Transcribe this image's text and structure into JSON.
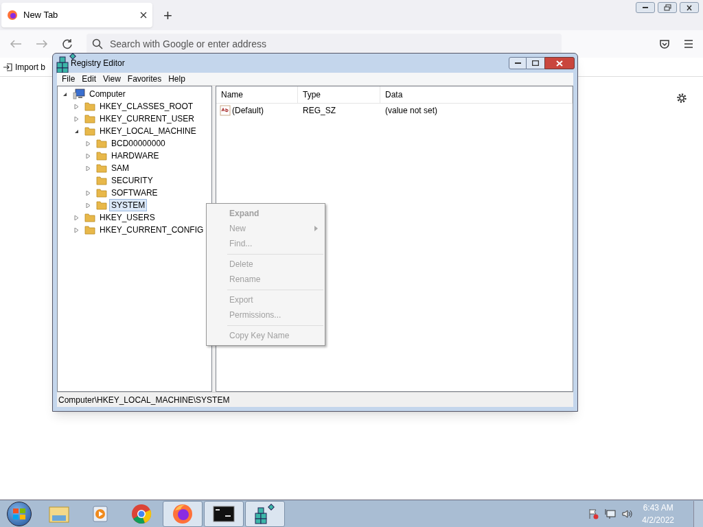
{
  "browser": {
    "tabs": [
      {
        "title": "New Tab",
        "selected": true
      }
    ],
    "new_tab": "+",
    "search": {
      "placeholder": "Search with Google or enter address"
    },
    "bookmarks_toolbar": {
      "import": "Import b"
    }
  },
  "registry_editor": {
    "title": "Registry Editor",
    "menu": [
      "File",
      "Edit",
      "View",
      "Favorites",
      "Help"
    ],
    "tree": [
      {
        "label": "Computer",
        "expanded": true,
        "kind": "computer",
        "selected": false,
        "children": [
          {
            "label": "HKEY_CLASSES_ROOT",
            "expanded": false,
            "selected": false
          },
          {
            "label": "HKEY_CURRENT_USER",
            "expanded": false,
            "selected": false
          },
          {
            "label": "HKEY_LOCAL_MACHINE",
            "expanded": true,
            "selected": false,
            "children": [
              {
                "label": "BCD00000000",
                "expanded": false,
                "selected": false
              },
              {
                "label": "HARDWARE",
                "expanded": false,
                "selected": false
              },
              {
                "label": "SAM",
                "expanded": false,
                "selected": false
              },
              {
                "label": "SECURITY",
                "selected": false
              },
              {
                "label": "SOFTWARE",
                "expanded": false,
                "selected": false
              },
              {
                "label": "SYSTEM",
                "expanded": false,
                "selected": true
              }
            ]
          },
          {
            "label": "HKEY_USERS",
            "expanded": false,
            "selected": false
          },
          {
            "label": "HKEY_CURRENT_CONFIG",
            "expanded": false,
            "selected": false
          }
        ]
      }
    ],
    "columns": [
      "Name",
      "Type",
      "Data"
    ],
    "rows": [
      {
        "name": "(Default)",
        "type": "REG_SZ",
        "data": "(value not set)"
      }
    ],
    "status_bar": "Computer\\HKEY_LOCAL_MACHINE\\SYSTEM"
  },
  "context_menu": [
    {
      "kind": "item",
      "label": "Expand",
      "default": true,
      "disabled": true,
      "submenu": false
    },
    {
      "kind": "item",
      "label": "New",
      "default": false,
      "disabled": true,
      "submenu": true
    },
    {
      "kind": "item",
      "label": "Find...",
      "default": false,
      "disabled": true,
      "submenu": false
    },
    {
      "kind": "separator"
    },
    {
      "kind": "item",
      "label": "Delete",
      "default": false,
      "disabled": true,
      "submenu": false
    },
    {
      "kind": "item",
      "label": "Rename",
      "default": false,
      "disabled": true,
      "submenu": false
    },
    {
      "kind": "separator"
    },
    {
      "kind": "item",
      "label": "Export",
      "default": false,
      "disabled": true,
      "submenu": false
    },
    {
      "kind": "item",
      "label": "Permissions...",
      "default": false,
      "disabled": true,
      "submenu": false
    },
    {
      "kind": "separator"
    },
    {
      "kind": "item",
      "label": "Copy Key Name",
      "default": false,
      "disabled": true,
      "submenu": false
    }
  ],
  "taskbar": {
    "apps": [
      {
        "kind": "explorer",
        "active": false
      },
      {
        "kind": "media",
        "active": false
      },
      {
        "kind": "chrome",
        "active": false
      },
      {
        "kind": "firefox",
        "active": true
      },
      {
        "kind": "cmd",
        "active": true
      },
      {
        "kind": "regedit",
        "active": true
      }
    ],
    "clock": {
      "time": "6:43 AM",
      "date": "4/2/2022"
    }
  }
}
